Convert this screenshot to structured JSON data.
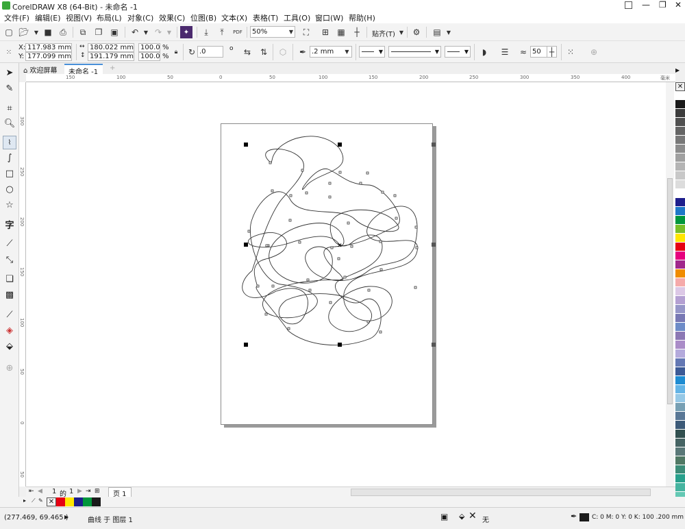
{
  "window": {
    "title": "CorelDRAW X8 (64-Bit) - 未命名 -1"
  },
  "menu": [
    "文件(F)",
    "编辑(E)",
    "视图(V)",
    "布局(L)",
    "对象(C)",
    "效果(C)",
    "位图(B)",
    "文本(X)",
    "表格(T)",
    "工具(O)",
    "窗口(W)",
    "帮助(H)"
  ],
  "toolbar": {
    "zoom": "50%",
    "snap_label": "贴齐(T)",
    "pdf_label": "PDF"
  },
  "props": {
    "x": "117.983 mm",
    "y": "177.099 mm",
    "width": "180.022 mm",
    "height": "191.179 mm",
    "scale_x": "100.0",
    "scale_y": "100.0",
    "percent": "%",
    "angle": ".0",
    "outline_width": ".2 mm",
    "smooth": "50"
  },
  "tabs": {
    "welcome": "欢迎屏幕",
    "document": "未命名 -1"
  },
  "ruler": {
    "h_ticks": [
      "150",
      "100",
      "50",
      "0",
      "50",
      "100",
      "150",
      "200",
      "250",
      "300",
      "350",
      "400"
    ],
    "h_unit": "毫米",
    "v_ticks": [
      "300",
      "250",
      "200",
      "150",
      "100",
      "50",
      "0",
      "50"
    ]
  },
  "pagenav": {
    "current": "1",
    "of": "的",
    "total": "1",
    "page_tab": "页 1"
  },
  "status": {
    "coords": "(277.469, 69.465 )",
    "object": "曲线 于 图层 1",
    "fill": "无",
    "outline": "C: 0 M: 0 Y: 0 K: 100  .200 mm"
  },
  "palette": [
    "#ffffff",
    "#1a1a1a",
    "#3c3c3c",
    "#505050",
    "#646464",
    "#787878",
    "#8c8c8c",
    "#a0a0a0",
    "#b4b4b4",
    "#c8c8c8",
    "#dcdcdc",
    "#ffffff",
    "#1e1e8c",
    "#1e78c8",
    "#00963c",
    "#78be28",
    "#ffe600",
    "#e60012",
    "#e6007e",
    "#a0288c",
    "#f08c00",
    "#f5aaaa",
    "#dcc8e6",
    "#b4a0d2",
    "#9696c8",
    "#7878b4",
    "#6e8cc8",
    "#8c78b4",
    "#aa8cc8",
    "#b4aadc",
    "#6478b4",
    "#3c5a96",
    "#1e8cd2",
    "#64b4e6",
    "#96c8e6",
    "#78a0b4",
    "#5a7896",
    "#3c5a78",
    "#325050",
    "#466464",
    "#5a7878",
    "#507864",
    "#3c8c78",
    "#28a08c",
    "#46b4a0",
    "#64c8b4",
    "#82dcc8"
  ],
  "doc_palette": [
    "#ffffff",
    "#e60012",
    "#ffe600",
    "#1e1e8c",
    "#00963c",
    "#1a1a1a"
  ]
}
